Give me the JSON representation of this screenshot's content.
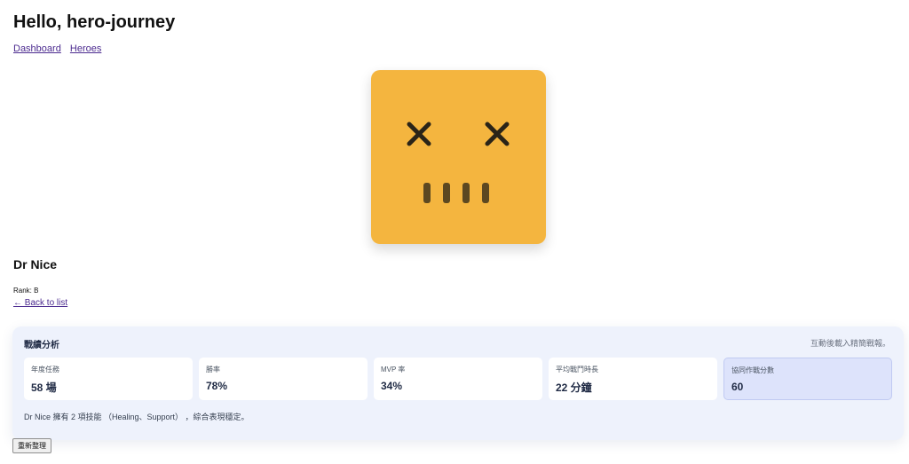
{
  "header": {
    "greeting": "Hello, hero-journey"
  },
  "nav": {
    "links": [
      {
        "label": "Dashboard"
      },
      {
        "label": "Heroes"
      }
    ]
  },
  "avatar": {
    "color": "#F4B53F",
    "feature_color": "#2a2418"
  },
  "hero": {
    "name": "Dr Nice",
    "rank": "Rank: B",
    "back_link": "← Back to list"
  },
  "analysis": {
    "title": "戰績分析",
    "hint": "互動後載入精簡戰報。",
    "stats": [
      {
        "label": "年度任務",
        "value": "58 場"
      },
      {
        "label": "勝率",
        "value": "78%"
      },
      {
        "label": "MVP 率",
        "value": "34%"
      },
      {
        "label": "平均戰鬥時長",
        "value": "22 分鐘"
      },
      {
        "label": "協同作戰分數",
        "value": "60"
      }
    ],
    "summary": "Dr Nice 擁有 2 項技能 （Healing、Support） ，綜合表現穩定。"
  },
  "actions": {
    "refresh_label": "重新整理"
  }
}
